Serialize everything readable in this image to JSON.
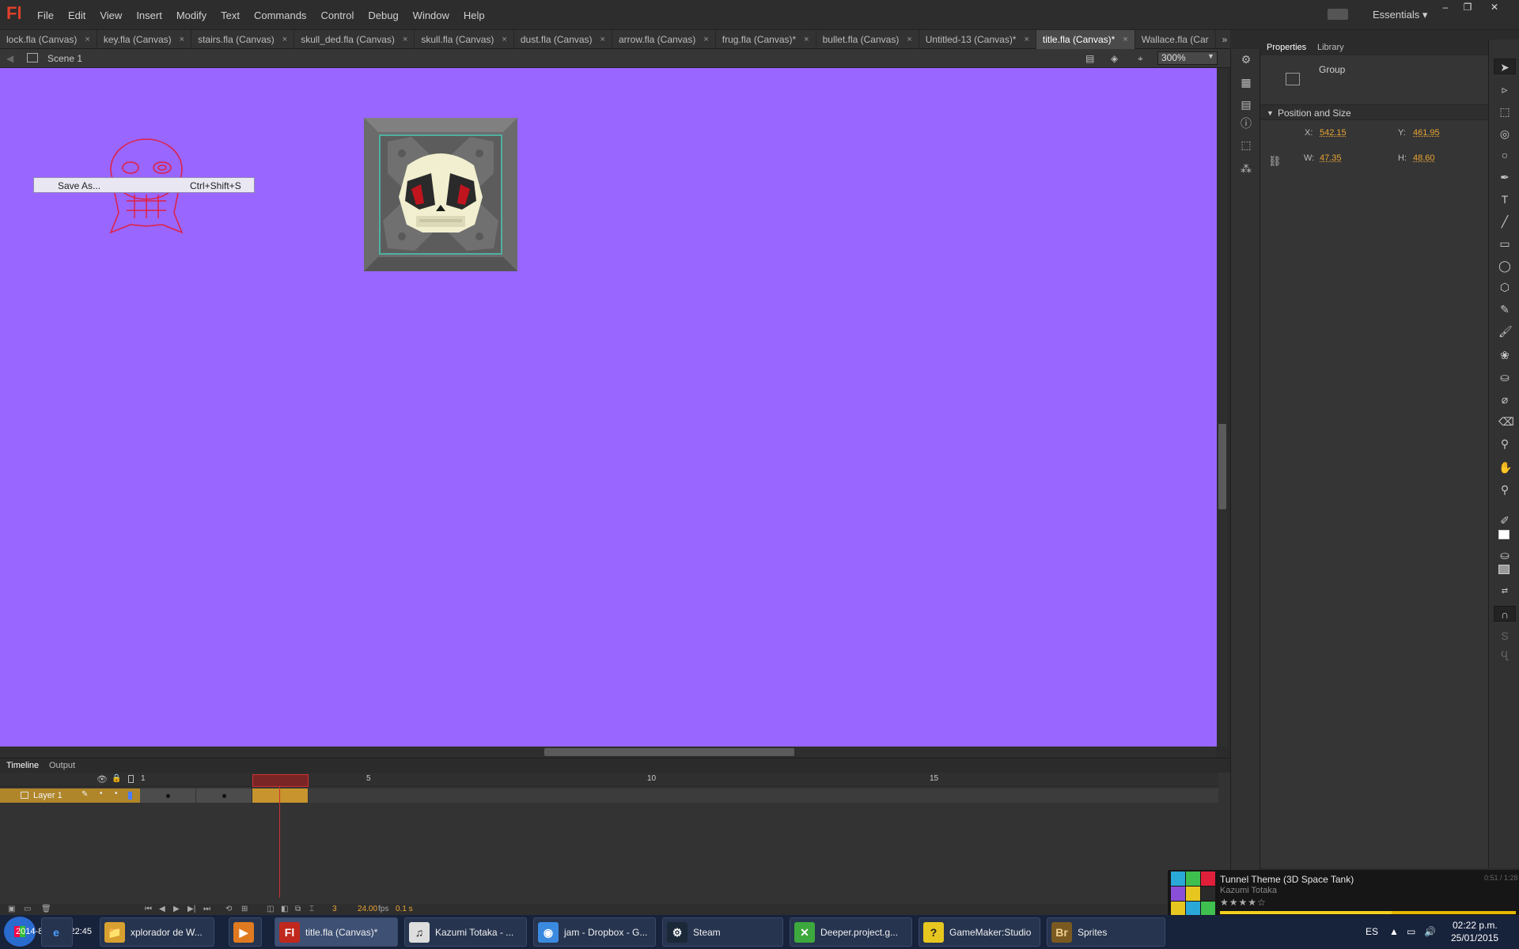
{
  "app": {
    "logo": "Fl",
    "menus": [
      "File",
      "Edit",
      "View",
      "Insert",
      "Modify",
      "Text",
      "Commands",
      "Control",
      "Debug",
      "Window",
      "Help"
    ],
    "workspace": "Essentials",
    "window_controls": [
      "–",
      "❐",
      "✕"
    ]
  },
  "tabs": [
    {
      "label": "lock.fla (Canvas)",
      "active": false
    },
    {
      "label": "key.fla (Canvas)",
      "active": false
    },
    {
      "label": "stairs.fla (Canvas)",
      "active": false
    },
    {
      "label": "skull_ded.fla (Canvas)",
      "active": false
    },
    {
      "label": "skull.fla (Canvas)",
      "active": false
    },
    {
      "label": "dust.fla (Canvas)",
      "active": false
    },
    {
      "label": "arrow.fla (Canvas)",
      "active": false
    },
    {
      "label": "frug.fla (Canvas)*",
      "active": false
    },
    {
      "label": "bullet.fla (Canvas)",
      "active": false
    },
    {
      "label": "Untitled-13 (Canvas)*",
      "active": false
    },
    {
      "label": "title.fla (Canvas)*",
      "active": true
    },
    {
      "label": "Wallace.fla (Car",
      "active": false
    }
  ],
  "tab_close": "×",
  "editbar": {
    "scene": "Scene 1",
    "zoom": "300%"
  },
  "stage": {
    "background": "#9966ff"
  },
  "context_menu": {
    "label": "Save As...",
    "shortcut": "Ctrl+Shift+S"
  },
  "properties": {
    "tabs": [
      "Properties",
      "Library"
    ],
    "type": "Group",
    "section": "Position and Size",
    "x_label": "X:",
    "x": "542.15",
    "y_label": "Y:",
    "y": "461.95",
    "w_label": "W:",
    "w": "47.35",
    "h_label": "H:",
    "h": "48.60"
  },
  "timeline": {
    "tabs": [
      "Timeline",
      "Output"
    ],
    "layer": "Layer 1",
    "frame_numbers": [
      "1",
      "5",
      "10",
      "15"
    ],
    "current_frame": "3",
    "fps": "24.00",
    "fps_unit": "fps",
    "elapsed": "0.1 s"
  },
  "music": {
    "title": "Tunnel Theme (3D Space Tank)",
    "artist": "Kazumi Totaka",
    "time": "0:51 / 1:28",
    "rating": "★★★★☆",
    "progress": 0.58
  },
  "taskbar": {
    "start_overlay": "2014-8-25 10:22:45",
    "items": [
      {
        "label": "xplorador de W...",
        "icon": "explorer-icon",
        "color": "#d8a030",
        "glyph": "📁"
      },
      {
        "label": "",
        "icon": "media-player-icon",
        "color": "#e07a20",
        "glyph": "▶"
      },
      {
        "label": "title.fla (Canvas)*",
        "icon": "flash-icon",
        "color": "#c0281e",
        "glyph": "Fl"
      },
      {
        "label": "Kazumi Totaka - ...",
        "icon": "music-player-icon",
        "color": "#dddddd",
        "glyph": "♫"
      },
      {
        "label": "jam - Dropbox - G...",
        "icon": "chrome-icon",
        "color": "#3a8ae0",
        "glyph": "◉"
      },
      {
        "label": "Steam",
        "icon": "steam-icon",
        "color": "#1b2838",
        "glyph": "⚙"
      },
      {
        "label": "Deeper.project.g...",
        "icon": "gamemaker-icon",
        "color": "#3da83d",
        "glyph": "✕"
      },
      {
        "label": "GameMaker:Studio",
        "icon": "help-icon",
        "color": "#e8c620",
        "glyph": "?"
      },
      {
        "label": "Sprites",
        "icon": "bridge-icon",
        "color": "#7a5a20",
        "glyph": "Br"
      }
    ],
    "language": "ES",
    "time": "02:22 p.m.",
    "date": "25/01/2015"
  }
}
